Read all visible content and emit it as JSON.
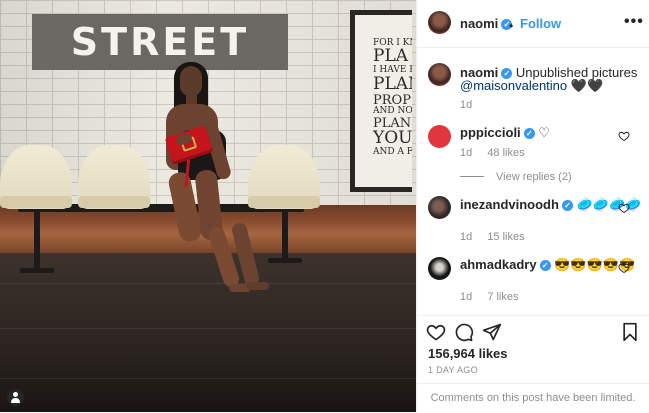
{
  "photo": {
    "street_sign": "STREET",
    "poster_lines": [
      "FOR I KN",
      "PLA",
      "I HAVE F",
      "PLAN",
      "PROPSE",
      "AND NOT T",
      "PLANS TO",
      "YOU H",
      "AND A FU"
    ]
  },
  "header": {
    "username": "naomi",
    "separator": "•",
    "follow_label": "Follow",
    "more_label": "•••"
  },
  "caption": {
    "username": "naomi",
    "text": "Unpublished pictures",
    "mention": "@maisonvalentino",
    "emoji": "🖤🖤",
    "time": "1d"
  },
  "comments": [
    {
      "username": "pppiccioli",
      "text": "♡",
      "time": "1d",
      "likes": "48 likes",
      "view_replies": "View replies (2)"
    },
    {
      "username": "inezandvinoodh",
      "text": "🥏🥏🥏🥏",
      "time": "1d",
      "likes": "15 likes"
    },
    {
      "username": "ahmadkadry",
      "text": "😎😎😎😎😎",
      "time": "1d",
      "likes": "7 likes"
    }
  ],
  "post": {
    "likes": "156,964 likes",
    "date": "1 DAY AGO",
    "comments_limited": "Comments on this post have been limited."
  },
  "icons": {
    "verified": "verified-badge-icon",
    "heart": "heart-icon",
    "comment": "comment-icon",
    "share": "share-icon",
    "save": "bookmark-icon",
    "user_tag": "user-tag-icon"
  },
  "colors": {
    "accent": "#3897f0",
    "text": "#262626",
    "muted": "#8e8e8e",
    "mention": "#003569"
  }
}
